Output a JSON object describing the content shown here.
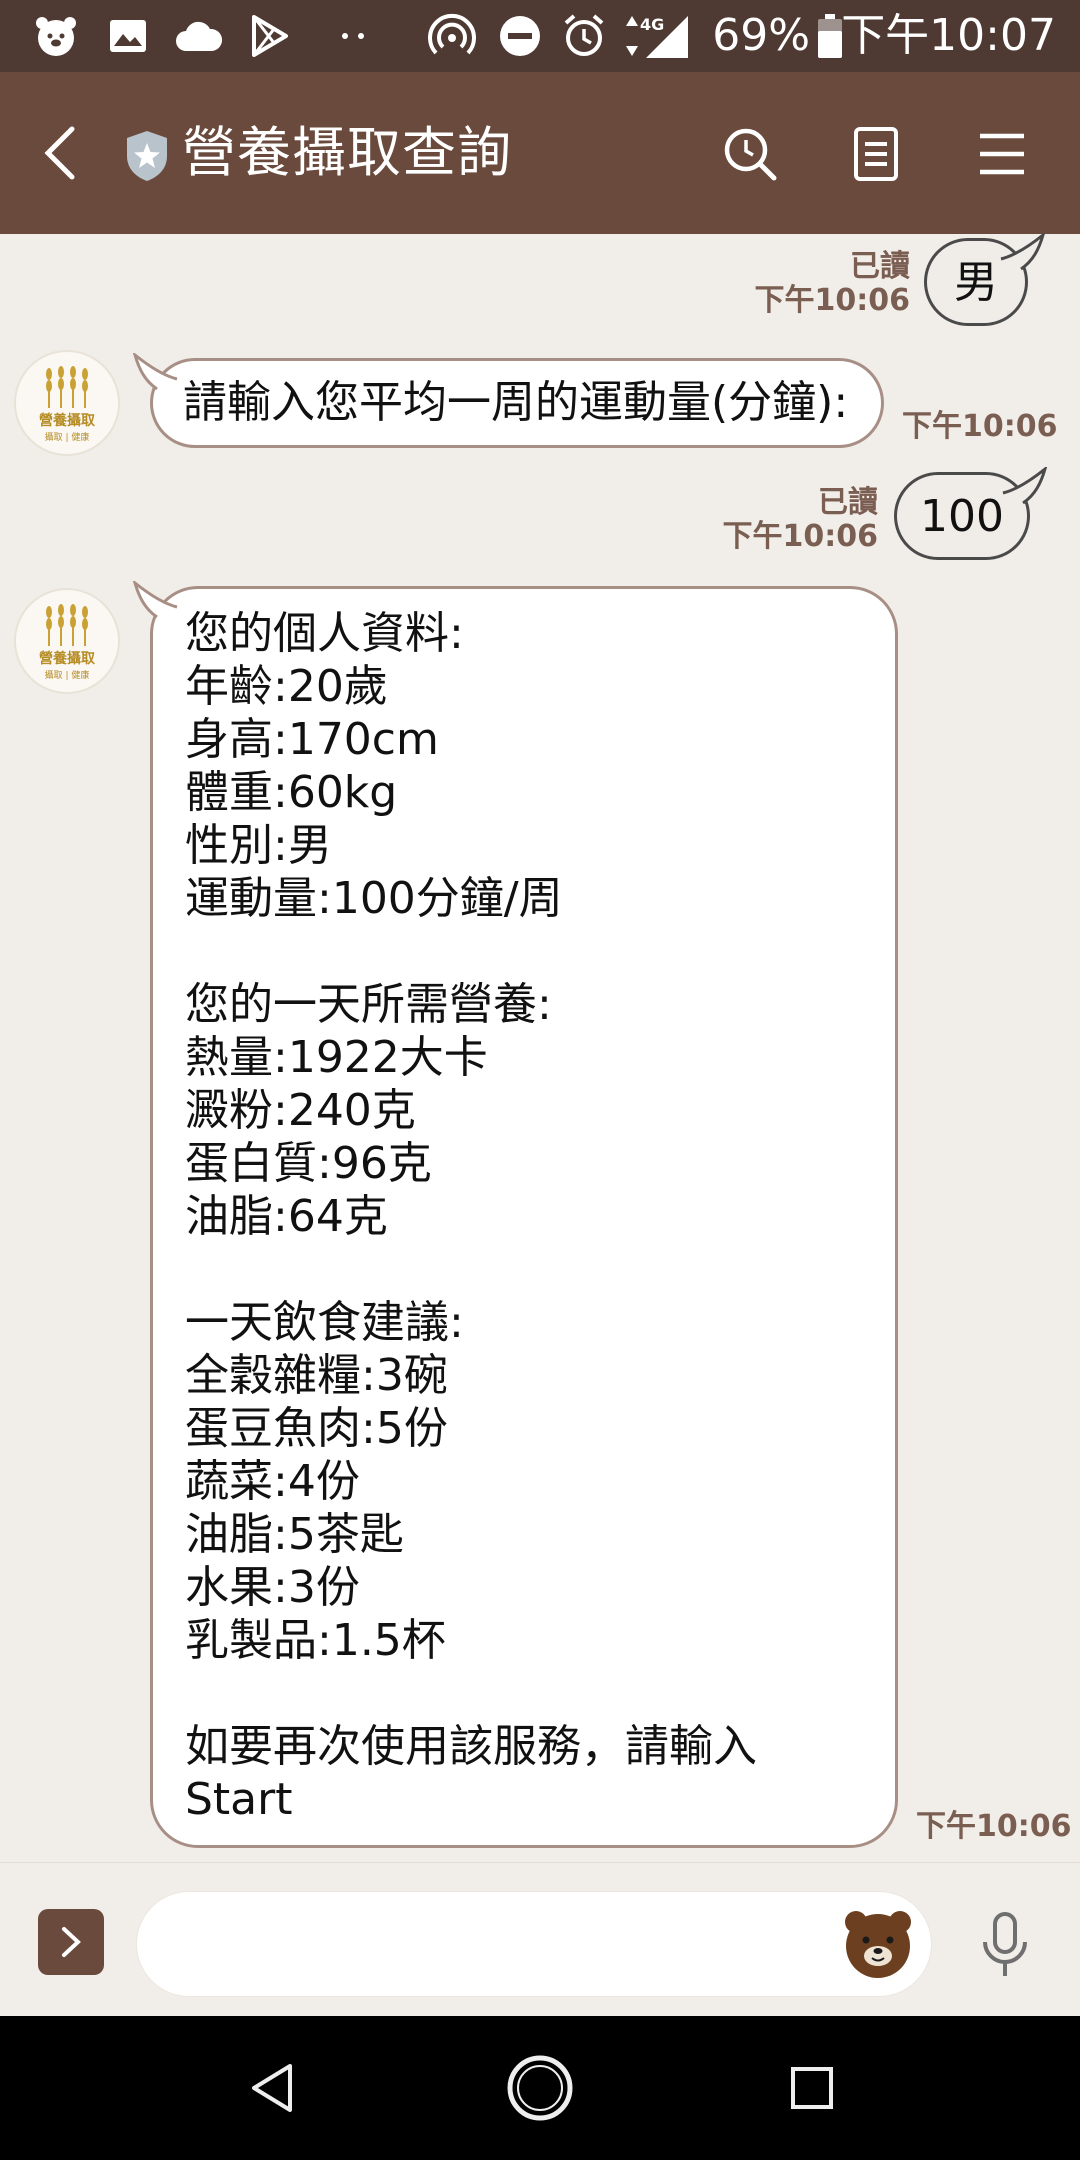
{
  "status_bar": {
    "battery_percent": "69%",
    "time": "下午10:07",
    "network": "4G",
    "icons": [
      "bear-icon",
      "image-icon",
      "cloud-icon",
      "play-store-icon",
      "more-dots-icon",
      "hotspot-icon",
      "do-not-disturb-icon",
      "alarm-icon",
      "signal-icon",
      "battery-icon"
    ]
  },
  "header": {
    "title": "營養攝取查詢",
    "icons": [
      "back-icon",
      "verified-shield-icon",
      "search-icon",
      "notes-icon",
      "menu-icon"
    ]
  },
  "messages": [
    {
      "id": "m1",
      "side": "out",
      "text": "男",
      "read": "已讀",
      "time": "下午10:06"
    },
    {
      "id": "m2",
      "side": "in",
      "text": "請輸入您平均一周的運動量(分鐘):",
      "time": "下午10:06"
    },
    {
      "id": "m3",
      "side": "out",
      "text": "100",
      "read": "已讀",
      "time": "下午10:06"
    },
    {
      "id": "m4",
      "side": "in",
      "lines": [
        "您的個人資料:",
        "年齡:20歲",
        "身高:170cm",
        "體重:60kg",
        "性別:男",
        "運動量:100分鐘/周",
        "",
        "您的一天所需營養:",
        "熱量:1922大卡",
        "澱粉:240克",
        "蛋白質:96克",
        "油脂:64克",
        "",
        "一天飲食建議:",
        "全穀雜糧:3碗",
        "蛋豆魚肉:5份",
        "蔬菜:4份",
        "油脂:5茶匙",
        "水果:3份",
        "乳製品:1.5杯",
        "",
        "如要再次使用該服務，請輸入",
        "Start"
      ],
      "time": "下午10:06"
    }
  ],
  "bot_avatar": {
    "label": "營養攝取",
    "sub": "攝取 | 健康"
  },
  "input_bar": {
    "placeholder": ""
  },
  "colors": {
    "header": "#6a4a3c",
    "status_bar": "#4e3a32",
    "chat_bg": "#f1eeea",
    "accent_text": "#7b5e52"
  }
}
